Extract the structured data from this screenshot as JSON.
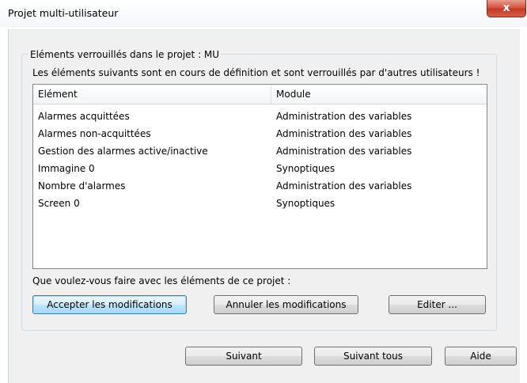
{
  "window": {
    "title": "Projet multi-utilisateur",
    "close_symbol": "x"
  },
  "locked": {
    "group_label": "Eléments verrouillés dans le projet : MU",
    "description": "Les éléments suivants sont en cours de définition et sont verrouillés par d'autres utilisateurs !",
    "columns": {
      "element": "Elément",
      "module": "Module"
    },
    "rows": [
      {
        "element": "Alarmes acquittées",
        "module": "Administration des variables"
      },
      {
        "element": "Alarmes non-acquittées",
        "module": "Administration des variables"
      },
      {
        "element": "Gestion des alarmes active/inactive",
        "module": "Administration des variables"
      },
      {
        "element": "Immagine 0",
        "module": "Synoptiques"
      },
      {
        "element": "Nombre d'alarmes",
        "module": "Administration des variables"
      },
      {
        "element": "Screen 0",
        "module": "Synoptiques"
      }
    ]
  },
  "question": "Que voulez-vous faire avec les éléments de ce projet :",
  "actions": {
    "accept": "Accepter les modifications",
    "cancel": "Annuler les modifications",
    "edit": "Editer ..."
  },
  "footer": {
    "next": "Suivant",
    "next_all": "Suivant tous",
    "help": "Aide"
  }
}
